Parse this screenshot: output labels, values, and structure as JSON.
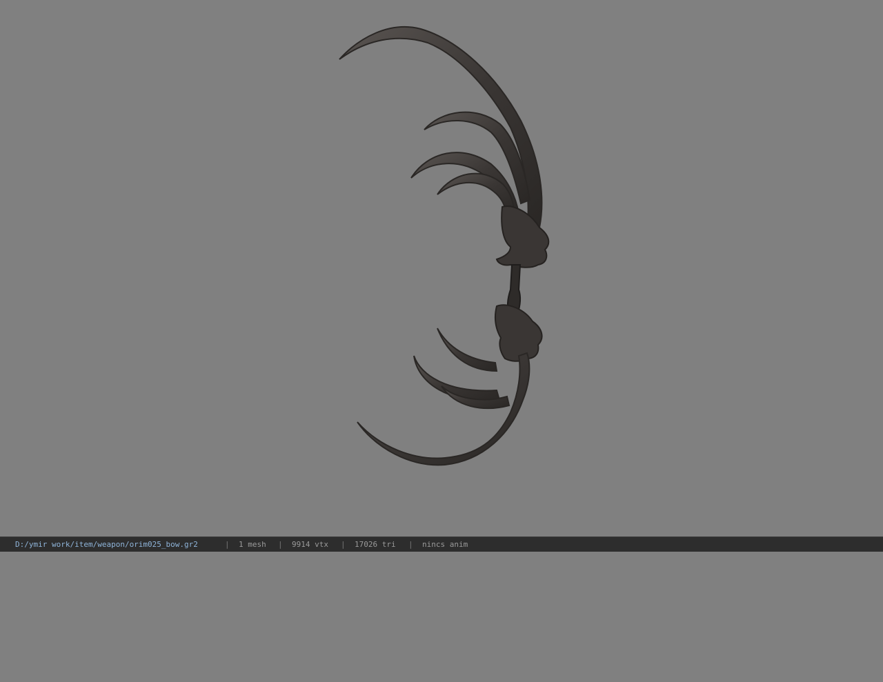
{
  "viewer": {
    "file_path": "D:/ymir work/item/weapon/orim025_bow.gr2",
    "meshes": "1 mesh",
    "vertices": "9914 vtx",
    "triangles": "17026 tri",
    "animation": "nincs anim",
    "separator": "|"
  },
  "colors": {
    "background": "#808080",
    "model": "#4a4644",
    "statusbar": "#2d2d2d"
  },
  "model_icon": "dragon-bow-model"
}
